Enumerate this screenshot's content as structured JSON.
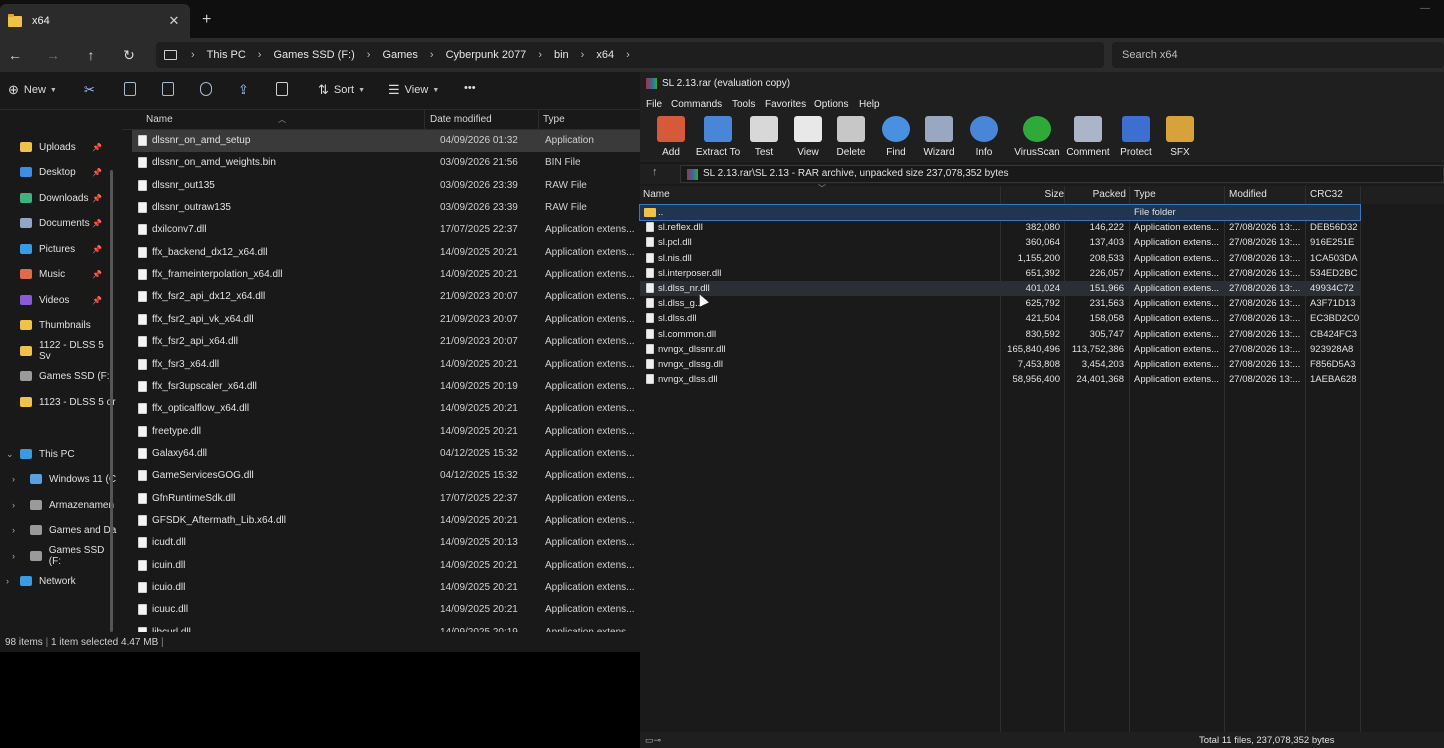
{
  "explorer": {
    "tab_title": "x64",
    "tab_close": "✕",
    "new_tab": "+",
    "breadcrumbs": [
      "This PC",
      "Games SSD (F:)",
      "Games",
      "Cyberpunk 2077",
      "bin",
      "x64"
    ],
    "search_placeholder": "Search x64",
    "commands": {
      "new": "New",
      "sort": "Sort",
      "view": "View",
      "more": "•••"
    },
    "nav_items": [
      {
        "label": "Uploads",
        "pinned": true,
        "color": "#f1c24a"
      },
      {
        "label": "Desktop",
        "pinned": true,
        "color": "#3d8ee0"
      },
      {
        "label": "Downloads",
        "pinned": true,
        "color": "#3fb27f"
      },
      {
        "label": "Documents",
        "pinned": true,
        "color": "#8fa6c9"
      },
      {
        "label": "Pictures",
        "pinned": true,
        "color": "#3b9be0"
      },
      {
        "label": "Music",
        "pinned": true,
        "color": "#e06a4b"
      },
      {
        "label": "Videos",
        "pinned": true,
        "color": "#8a5bd6"
      },
      {
        "label": "Thumbnails",
        "pinned": false,
        "color": "#f1c24a"
      },
      {
        "label": "1122 - DLSS 5 Sv",
        "pinned": false,
        "color": "#f1c24a"
      },
      {
        "label": "Games SSD (F:)",
        "pinned": false,
        "color": "#9a9a9a"
      },
      {
        "label": "1123 - DLSS 5 or",
        "pinned": false,
        "color": "#f1c24a"
      }
    ],
    "tree_items": [
      {
        "label": "This PC",
        "expanded": true,
        "color": "#3b9be0"
      },
      {
        "label": "Windows 11 (C",
        "expanded": false,
        "color": "#5aa0e0"
      },
      {
        "label": "Armazenamen",
        "expanded": false,
        "color": "#9a9a9a"
      },
      {
        "label": "Games and Da",
        "expanded": false,
        "color": "#9a9a9a"
      },
      {
        "label": "Games SSD (F:",
        "expanded": false,
        "color": "#9a9a9a"
      },
      {
        "label": "Network",
        "expanded": false,
        "color": "#3b9be0"
      }
    ],
    "columns": {
      "name": "Name",
      "date": "Date modified",
      "type": "Type"
    },
    "files": [
      {
        "name": "dlssnr_on_amd_setup",
        "date": "04/09/2026 01:32",
        "type": "Application",
        "selected": true
      },
      {
        "name": "dlssnr_on_amd_weights.bin",
        "date": "03/09/2026 21:56",
        "type": "BIN File"
      },
      {
        "name": "dlssnr_out135",
        "date": "03/09/2026 23:39",
        "type": "RAW File"
      },
      {
        "name": "dlssnr_outraw135",
        "date": "03/09/2026 23:39",
        "type": "RAW File"
      },
      {
        "name": "dxilconv7.dll",
        "date": "17/07/2025 22:37",
        "type": "Application extens..."
      },
      {
        "name": "ffx_backend_dx12_x64.dll",
        "date": "14/09/2025 20:21",
        "type": "Application extens..."
      },
      {
        "name": "ffx_frameinterpolation_x64.dll",
        "date": "14/09/2025 20:21",
        "type": "Application extens..."
      },
      {
        "name": "ffx_fsr2_api_dx12_x64.dll",
        "date": "21/09/2023 20:07",
        "type": "Application extens..."
      },
      {
        "name": "ffx_fsr2_api_vk_x64.dll",
        "date": "21/09/2023 20:07",
        "type": "Application extens..."
      },
      {
        "name": "ffx_fsr2_api_x64.dll",
        "date": "21/09/2023 20:07",
        "type": "Application extens..."
      },
      {
        "name": "ffx_fsr3_x64.dll",
        "date": "14/09/2025 20:21",
        "type": "Application extens..."
      },
      {
        "name": "ffx_fsr3upscaler_x64.dll",
        "date": "14/09/2025 20:19",
        "type": "Application extens..."
      },
      {
        "name": "ffx_opticalflow_x64.dll",
        "date": "14/09/2025 20:21",
        "type": "Application extens..."
      },
      {
        "name": "freetype.dll",
        "date": "14/09/2025 20:21",
        "type": "Application extens..."
      },
      {
        "name": "Galaxy64.dll",
        "date": "04/12/2025 15:32",
        "type": "Application extens..."
      },
      {
        "name": "GameServicesGOG.dll",
        "date": "04/12/2025 15:32",
        "type": "Application extens..."
      },
      {
        "name": "GfnRuntimeSdk.dll",
        "date": "17/07/2025 22:37",
        "type": "Application extens..."
      },
      {
        "name": "GFSDK_Aftermath_Lib.x64.dll",
        "date": "14/09/2025 20:21",
        "type": "Application extens..."
      },
      {
        "name": "icudt.dll",
        "date": "14/09/2025 20:13",
        "type": "Application extens..."
      },
      {
        "name": "icuin.dll",
        "date": "14/09/2025 20:21",
        "type": "Application extens..."
      },
      {
        "name": "icuio.dll",
        "date": "14/09/2025 20:21",
        "type": "Application extens..."
      },
      {
        "name": "icuuc.dll",
        "date": "14/09/2025 20:21",
        "type": "Application extens..."
      },
      {
        "name": "libcurl.dll",
        "date": "14/09/2025 20:19",
        "type": "Application extens..."
      }
    ],
    "status": {
      "count": "98 items",
      "selection": "1 item selected  4.47 MB"
    }
  },
  "rar": {
    "title": "SL 2.13.rar (evaluation copy)",
    "menu": [
      "File",
      "Commands",
      "Tools",
      "Favorites",
      "Options",
      "Help"
    ],
    "tools": [
      {
        "label": "Add",
        "color": "#d65a3a"
      },
      {
        "label": "Extract To",
        "color": "#4a86d8"
      },
      {
        "label": "Test",
        "color": "#d8d8d8"
      },
      {
        "label": "View",
        "color": "#e8e8e8"
      },
      {
        "label": "Delete",
        "color": "#c7c7c7"
      },
      {
        "label": "Find",
        "color": "#4a90e0"
      },
      {
        "label": "Wizard",
        "color": "#9aa7c0"
      },
      {
        "label": "Info",
        "color": "#4a86d8"
      },
      {
        "label": "VirusScan",
        "color": "#2faa3a"
      },
      {
        "label": "Comment",
        "color": "#aab6c8"
      },
      {
        "label": "Protect",
        "color": "#3c6fd0"
      },
      {
        "label": "SFX",
        "color": "#d8a23a"
      }
    ],
    "path": "SL 2.13.rar\\SL 2.13 - RAR archive, unpacked size 237,078,352 bytes",
    "columns": {
      "name": "Name",
      "size": "Size",
      "packed": "Packed",
      "type": "Type",
      "modified": "Modified",
      "crc": "CRC32"
    },
    "rows": [
      {
        "name": "..",
        "size": "",
        "packed": "",
        "type": "File folder",
        "modified": "",
        "crc": "",
        "folder": true,
        "selected": true
      },
      {
        "name": "sl.reflex.dll",
        "size": "382,080",
        "packed": "146,222",
        "type": "Application extens...",
        "modified": "27/08/2026 13:...",
        "crc": "DEB56D32"
      },
      {
        "name": "sl.pcl.dll",
        "size": "360,064",
        "packed": "137,403",
        "type": "Application extens...",
        "modified": "27/08/2026 13:...",
        "crc": "916E251E"
      },
      {
        "name": "sl.nis.dll",
        "size": "1,155,200",
        "packed": "208,533",
        "type": "Application extens...",
        "modified": "27/08/2026 13:...",
        "crc": "1CA503DA"
      },
      {
        "name": "sl.interposer.dll",
        "size": "651,392",
        "packed": "226,057",
        "type": "Application extens...",
        "modified": "27/08/2026 13:...",
        "crc": "534ED2BC"
      },
      {
        "name": "sl.dlss_nr.dll",
        "size": "401,024",
        "packed": "151,966",
        "type": "Application extens...",
        "modified": "27/08/2026 13:...",
        "crc": "49934C72",
        "hover": true
      },
      {
        "name": "sl.dlss_g...",
        "size": "625,792",
        "packed": "231,563",
        "type": "Application extens...",
        "modified": "27/08/2026 13:...",
        "crc": "A3F71D13"
      },
      {
        "name": "sl.dlss.dll",
        "size": "421,504",
        "packed": "158,058",
        "type": "Application extens...",
        "modified": "27/08/2026 13:...",
        "crc": "EC3BD2C0"
      },
      {
        "name": "sl.common.dll",
        "size": "830,592",
        "packed": "305,747",
        "type": "Application extens...",
        "modified": "27/08/2026 13:...",
        "crc": "CB424FC3"
      },
      {
        "name": "nvngx_dlssnr.dll",
        "size": "165,840,496",
        "packed": "113,752,386",
        "type": "Application extens...",
        "modified": "27/08/2026 13:...",
        "crc": "923928A8"
      },
      {
        "name": "nvngx_dlssg.dll",
        "size": "7,453,808",
        "packed": "3,454,203",
        "type": "Application extens...",
        "modified": "27/08/2026 13:...",
        "crc": "F856D5A3"
      },
      {
        "name": "nvngx_dlss.dll",
        "size": "58,956,400",
        "packed": "24,401,368",
        "type": "Application extens...",
        "modified": "27/08/2026 13:...",
        "crc": "1AEBA628"
      }
    ],
    "status_total": "Total 11 files, 237,078,352 bytes"
  }
}
